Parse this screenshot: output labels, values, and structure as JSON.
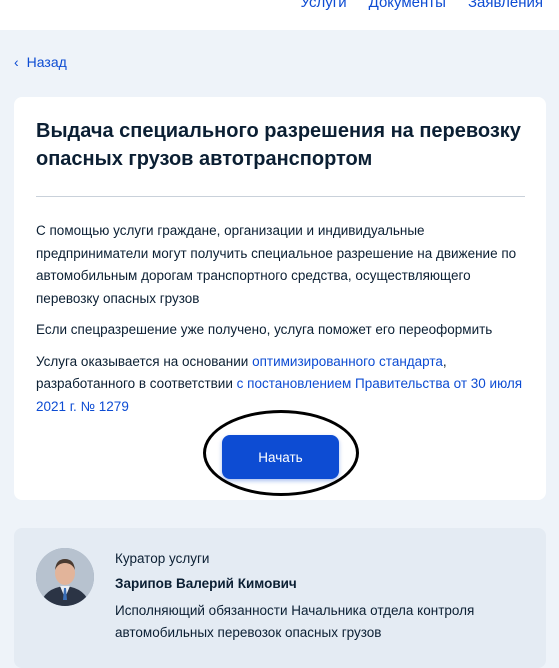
{
  "nav": {
    "items": [
      "Услуги",
      "Документы",
      "Заявления"
    ]
  },
  "back_label": "Назад",
  "service": {
    "title": "Выдача специального разрешения на перевозку опасных грузов автотранспортом",
    "paragraph1": "С помощью услуги граждане, организации и индивидуальные предприниматели могут получить специальное разрешение на движение по автомобильным дорогам транспортного средства, осуществляющего перевозку опасных грузов",
    "paragraph2": "Если спецразрешение уже получено, услуга поможет его переоформить",
    "paragraph3_prefix": "Услуга оказывается на основании ",
    "paragraph3_link1": "оптимизированного стандарта",
    "paragraph3_middle": ", разработанного в соответствии ",
    "paragraph3_link2": "с постановлением Правительства от 30 июля 2021 г. № 1279",
    "start_label": "Начать"
  },
  "curator": {
    "role": "Куратор услуги",
    "name": "Зарипов Валерий Кимович",
    "position": "Исполняющий обязанности Начальника отдела контроля автомобильных перевозок опасных грузов"
  },
  "colors": {
    "accent": "#0d4cd3",
    "background": "#eef3f9",
    "text": "#0b1f33"
  }
}
